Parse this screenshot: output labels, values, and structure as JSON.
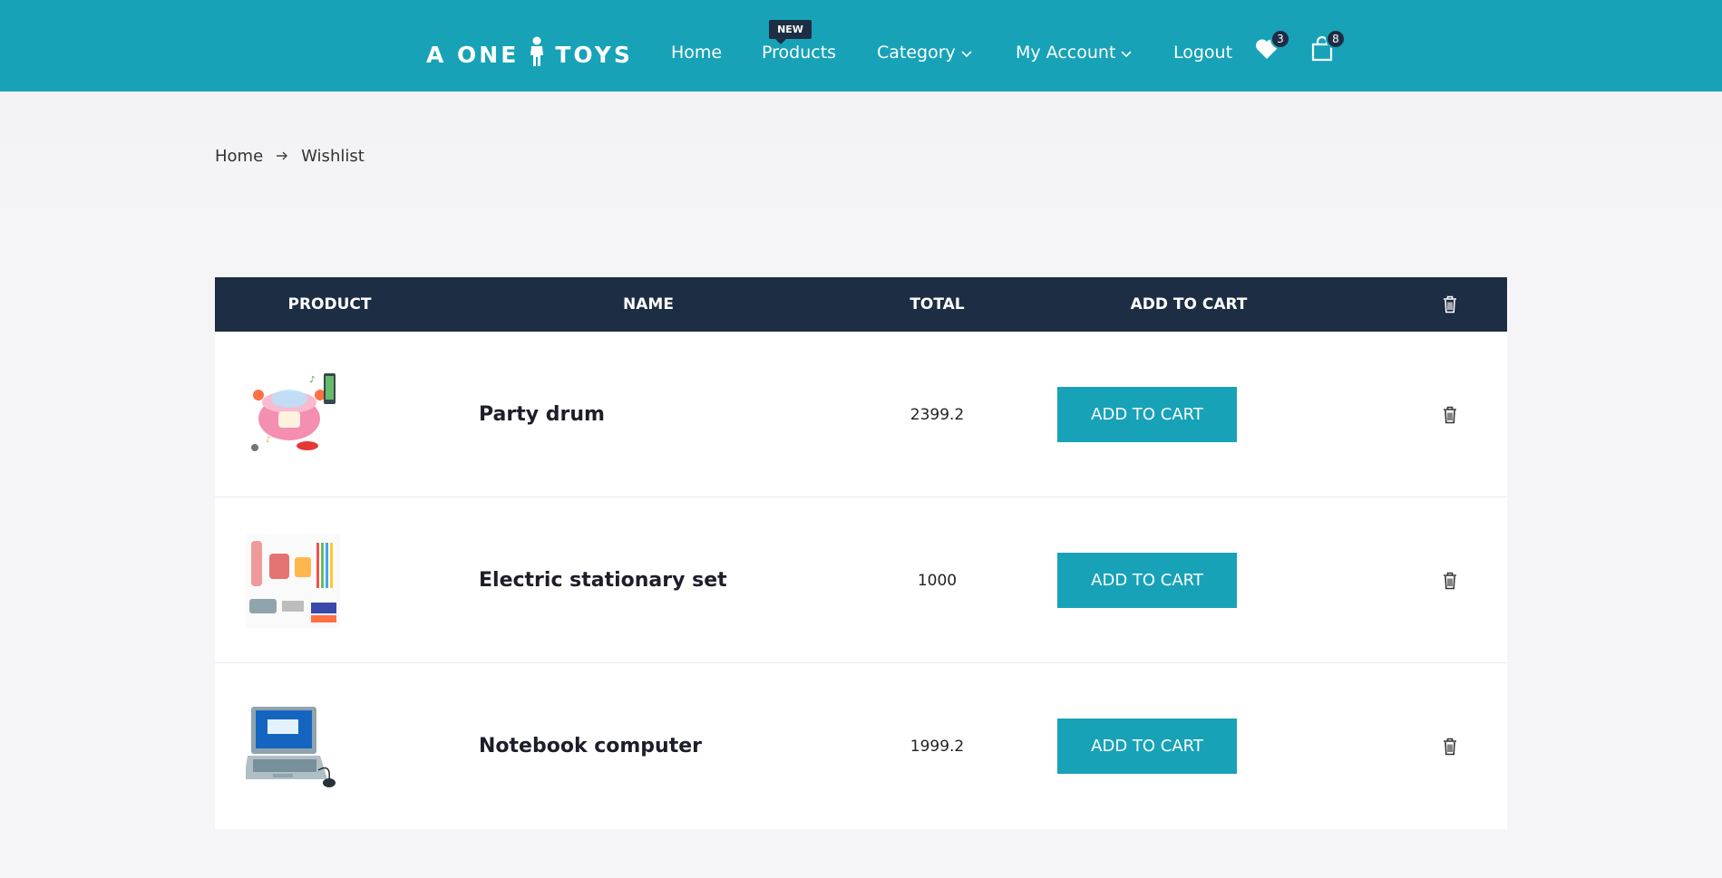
{
  "header": {
    "logo_left": "A ONE",
    "logo_right": "TOYS",
    "nav": {
      "home": "Home",
      "products": "Products",
      "products_badge": "NEW",
      "category": "Category",
      "my_account": "My Account",
      "logout": "Logout"
    },
    "wishlist_count": "3",
    "cart_count": "8"
  },
  "breadcrumb": {
    "home": "Home",
    "current": "Wishlist"
  },
  "table": {
    "headers": {
      "product": "PRODUCT",
      "name": "NAME",
      "total": "TOTAL",
      "add_to_cart": "ADD TO CART"
    },
    "rows": [
      {
        "name": "Party drum",
        "total": "2399.2",
        "button": "ADD TO CART",
        "image_icon": "party-drum-toy-image"
      },
      {
        "name": "Electric stationary set",
        "total": "1000",
        "button": "ADD TO CART",
        "image_icon": "stationary-set-image"
      },
      {
        "name": "Notebook computer",
        "total": "1999.2",
        "button": "ADD TO CART",
        "image_icon": "notebook-computer-image"
      }
    ]
  },
  "colors": {
    "brand_teal": "#17a2b8",
    "dark_navy": "#1d2d44",
    "page_bg": "#f5f5f7"
  }
}
